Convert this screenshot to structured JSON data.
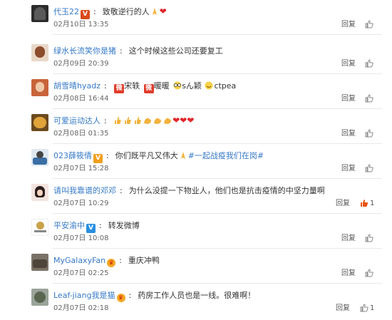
{
  "like_icon_color": "#8a8a8a",
  "like_active_color": "#e8530e",
  "reply_label": "回复",
  "comments": [
    {
      "user": "代玉22",
      "badge": "V",
      "text": "致敬逆行的人",
      "emoji_after": [
        "pray",
        "heart"
      ],
      "time": "02月10日 13:35",
      "likes": ""
    },
    {
      "user": "绿水长流笑你是猪",
      "text": "这个时候这些公司还要复工",
      "time": "02月09日 20:39",
      "likes": ""
    },
    {
      "user": "胡雪晴hyadz",
      "text_parts": [
        "宋轶",
        "暖暖",
        "sん颖",
        "ctpea"
      ],
      "time": "02月08日 16:44",
      "likes": ""
    },
    {
      "user": "可爱运动达人",
      "emojis": [
        "thumb",
        "thumb",
        "thumb",
        "muscle",
        "muscle",
        "muscle",
        "heart",
        "heart",
        "heart"
      ],
      "time": "02月08日 01:35",
      "likes": ""
    },
    {
      "user": "023薛筱倩",
      "badge": "V",
      "text": "你们既平凡又伟大",
      "topic": "#一起战疫我们在岗#",
      "time": "02月07日 15:28",
      "likes": ""
    },
    {
      "user": "请叫我靠谱的邓邓",
      "text": "为什么没提一下物业人，他们也是抗击疫情的中坚力量啊",
      "time": "02月07日 10:29",
      "likes": "1"
    },
    {
      "user": "平安渝中",
      "badge": "V",
      "text": "转发微博",
      "time": "02月07日 10:08",
      "likes": ""
    },
    {
      "user": "MyGalaxyFan",
      "vip": true,
      "text": "重庆冲鸭",
      "time": "02月07日 02:25",
      "likes": ""
    },
    {
      "user": "Leaf-jiang我是猫",
      "vip": true,
      "text": "药房工作人员也是一线。很难啊！",
      "time": "02月07日 02:18",
      "likes": "1"
    }
  ]
}
